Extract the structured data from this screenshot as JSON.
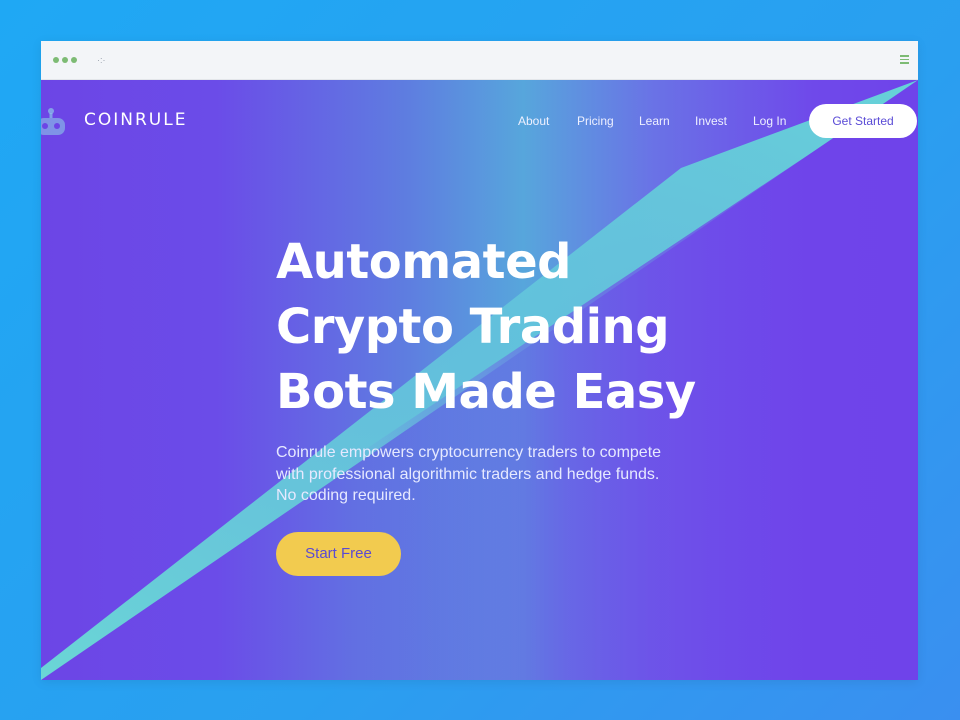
{
  "chrome": {
    "url_mark": "·:·"
  },
  "header": {
    "brand": "COINRULE",
    "nav": [
      "About",
      "Pricing",
      "Learn",
      "Invest",
      "Log In"
    ],
    "cta": "Get Started"
  },
  "hero": {
    "headline": [
      "Automated",
      "Crypto Trading",
      "Bots Made Easy"
    ],
    "subtext": "Coinrule empowers cryptocurrency traders to compete with professional algorithmic traders and hedge funds. No coding required.",
    "button": "Start Free"
  },
  "colors": {
    "page_bg": "#1fa8f4",
    "hero_purple": "#6f43ea",
    "hero_teal": "#66d3d8",
    "cta_yellow": "#f2cb4f",
    "window_dots": "#7dbb74"
  },
  "icons": {
    "logo": "robot-icon",
    "menu": "hamburger-icon",
    "window_controls": "dot-icon"
  }
}
